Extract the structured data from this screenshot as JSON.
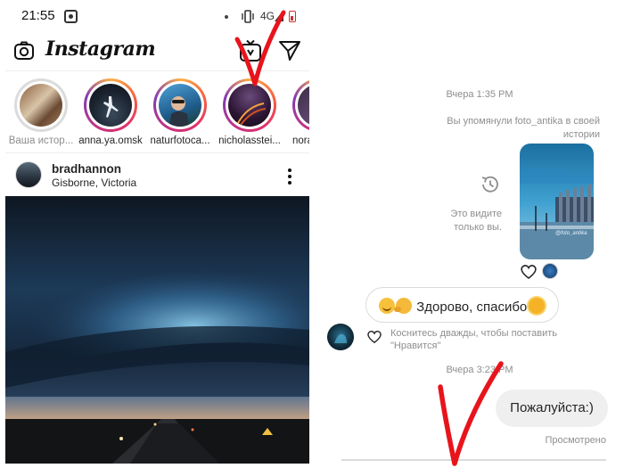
{
  "status_bar": {
    "time": "21:55",
    "network": "4G"
  },
  "header": {
    "brand": "Instagram"
  },
  "stories": [
    {
      "name": "Ваша истор...",
      "own": true
    },
    {
      "name": "anna.ya.omsk",
      "own": false
    },
    {
      "name": "naturfotoca...",
      "own": false
    },
    {
      "name": "nicholasstei...",
      "own": false
    },
    {
      "name": "nora",
      "own": false
    }
  ],
  "post": {
    "username": "bradhannon",
    "location": "Gisborne, Victoria"
  },
  "chat": {
    "timestamp_1": "Вчера 1:35 PM",
    "mention_text": "Вы упомянули foto_antika в своей истории",
    "only_you_text": "Это видите только вы.",
    "story_watermark": "@foto_antika",
    "incoming_message": "Здорово, спасибо",
    "double_tap_hint": "Коснитесь дважды, чтобы поставить \"Нравится\"",
    "timestamp_2": "Вчера 3:23 PM",
    "outgoing_message": "Пожалуйста:)",
    "seen_status": "Просмотрено"
  },
  "colors": {
    "story_ring": "#e1306c",
    "checkmark": "#e8141c",
    "secondary_text": "#8e8e8e"
  },
  "icons": [
    "camera-icon",
    "igtv-icon",
    "send-icon",
    "more-icon",
    "history-icon",
    "heart-icon"
  ]
}
